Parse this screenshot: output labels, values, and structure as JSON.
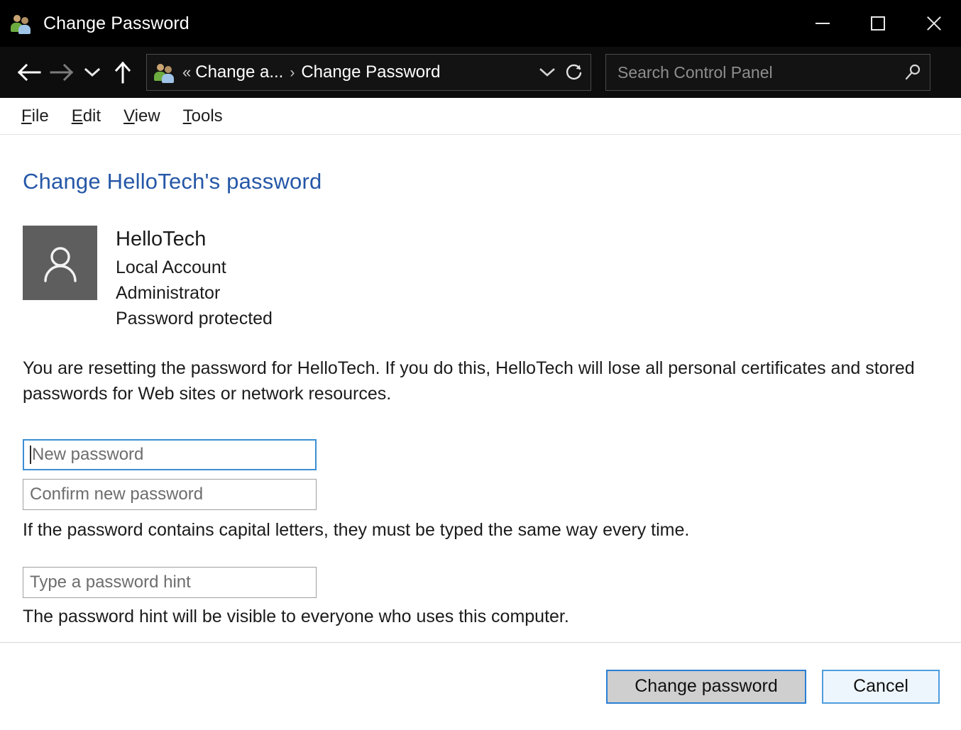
{
  "window": {
    "title": "Change Password",
    "icon": "user-accounts-icon",
    "controls": {
      "minimize": "minimize-icon",
      "maximize": "maximize-icon",
      "close": "close-icon"
    }
  },
  "nav": {
    "back": "back-arrow-icon",
    "forward": "forward-arrow-icon",
    "recent": "recent-locations-chevron-icon",
    "up": "up-arrow-icon",
    "breadcrumb": {
      "icon": "user-accounts-icon",
      "overflow": "«",
      "items": [
        {
          "label": "Change a...",
          "separator": "›"
        },
        {
          "label": "Change Password",
          "separator": ""
        }
      ],
      "dropdown": "chevron-down-icon",
      "refresh": "refresh-icon"
    }
  },
  "search": {
    "placeholder": "Search Control Panel",
    "value": "",
    "icon": "search-icon"
  },
  "menubar": {
    "items": [
      {
        "accel": "F",
        "rest": "ile"
      },
      {
        "accel": "E",
        "rest": "dit"
      },
      {
        "accel": "V",
        "rest": "iew"
      },
      {
        "accel": "T",
        "rest": "ools"
      }
    ]
  },
  "main": {
    "page_title": "Change HelloTech's password",
    "account": {
      "avatar_icon": "person-avatar-icon",
      "name": "HelloTech",
      "type": "Local Account",
      "role": "Administrator",
      "protection": "Password protected"
    },
    "warning_text": "You are resetting the password for HelloTech.  If you do this, HelloTech will lose all personal certificates and stored passwords for Web sites or network resources.",
    "fields": {
      "new_password": {
        "placeholder": "New password",
        "value": "",
        "focused": true
      },
      "confirm_password": {
        "placeholder": "Confirm new password",
        "value": "",
        "focused": false
      },
      "password_hint": {
        "placeholder": "Type a password hint",
        "value": "",
        "focused": false
      }
    },
    "capital_letters_note": "If the password contains capital letters, they must be typed the same way every time.",
    "hint_visibility_note": "The password hint will be visible to everyone who uses this computer."
  },
  "footer": {
    "primary_button": "Change password",
    "secondary_button": "Cancel"
  },
  "colors": {
    "titlebar_bg": "#000000",
    "navbar_bg": "#0d0d0d",
    "page_title": "#2557a7",
    "focus_border": "#3b8fd4",
    "avatar_bg": "#5e5e5e",
    "default_button_bg": "#cfcfcf",
    "secondary_button_bg": "#eef6fd"
  }
}
